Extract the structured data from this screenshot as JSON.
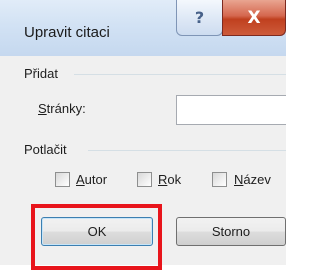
{
  "window": {
    "title": "Upravit citaci",
    "help_glyph": "?",
    "close_glyph": "X"
  },
  "add_group": {
    "label": "Přidat",
    "pages_label_accel": "S",
    "pages_label_rest": "tránky:",
    "pages_value": ""
  },
  "suppress_group": {
    "label": "Potlačit",
    "checkboxes": [
      {
        "accel": "A",
        "rest": "utor",
        "checked": false
      },
      {
        "accel": "R",
        "rest": "ok",
        "checked": false
      },
      {
        "accel": "N",
        "rest": "ázev",
        "checked": false
      }
    ]
  },
  "buttons": {
    "ok_label": "OK",
    "cancel_label": "Storno"
  },
  "colors": {
    "highlight": "#e8141b",
    "close_button": "#c7452a"
  }
}
